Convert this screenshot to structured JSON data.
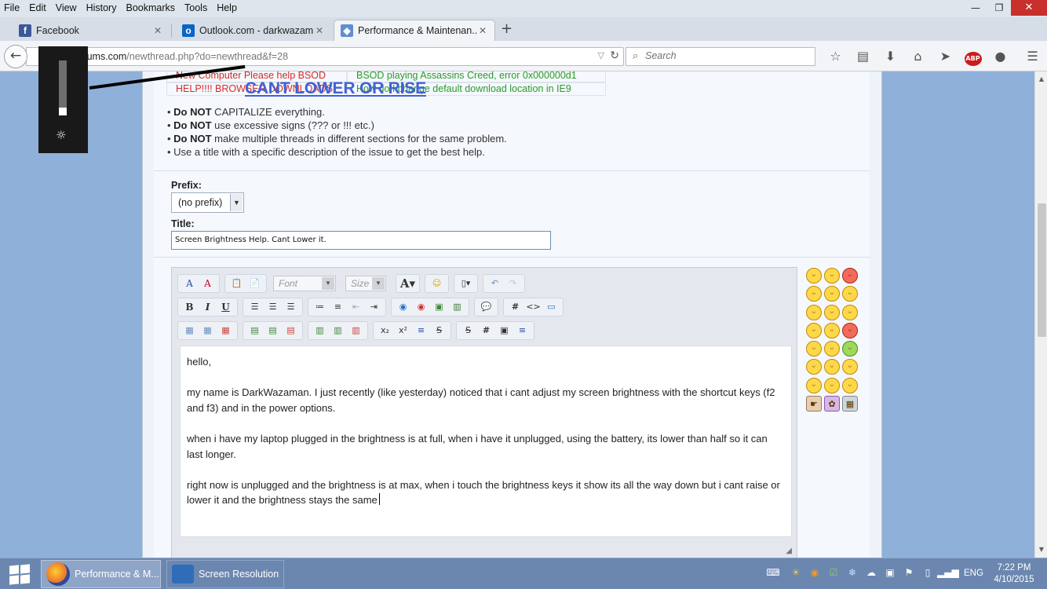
{
  "menu": [
    "File",
    "Edit",
    "View",
    "History",
    "Bookmarks",
    "Tools",
    "Help"
  ],
  "window_controls": {
    "minimize": "—",
    "restore": "❐",
    "close": "✕"
  },
  "tabs": [
    {
      "label": "Facebook",
      "icon": "f",
      "icon_color": "#3b5998"
    },
    {
      "label": "Outlook.com - darkwazam...",
      "icon": "o",
      "icon_color": "#0a64c4"
    },
    {
      "label": "Performance & Maintenan...",
      "icon": "◆",
      "icon_color": "#5f8fd0"
    }
  ],
  "new_tab": "+",
  "nav": {
    "url_domain": "forums.com",
    "url_path": "/newthread.php?do=newthread&f=28",
    "search_placeholder": "Search"
  },
  "similar_threads": [
    {
      "left": "New Computer Please help BSOD",
      "right": "BSOD playing Assassins Creed, error 0x000000d1"
    },
    {
      "left": "HELP!!!! BROWSER DOWNLOADS",
      "right": "How do I change default download location in IE9"
    }
  ],
  "annotation": "CANT LOWER OR  RISE",
  "brightness_level": 0.15,
  "rules": [
    {
      "bold": "Do NOT",
      "text": " CAPITALIZE everything."
    },
    {
      "bold": "Do NOT",
      "text": " use excessive signs (??? or !!! etc.)"
    },
    {
      "bold": "Do NOT",
      "text": " make multiple threads in different sections for the same problem."
    },
    {
      "bold": "",
      "text": "Use a title with a specific description of the issue to get the best help."
    }
  ],
  "form": {
    "prefix_label": "Prefix:",
    "prefix_value": "(no prefix)",
    "title_label": "Title:",
    "title_value": "Screen Brightness Help. Cant Lower it."
  },
  "editor": {
    "font_placeholder": "Font",
    "size_placeholder": "Size",
    "body": [
      "hello,",
      "my name is DarkWazaman. I just recently (like yesterday) noticed that i cant adjust my screen brightness with the shortcut keys (f2 and f3) and in the power options.",
      "when i have my laptop plugged in the brightness is at full, when i have it unplugged, using the battery, its lower than half so it can last longer.",
      "right now is unplugged and the brightness is at max, when i touch the brightness keys it show its all the way down but i cant raise or lower it and the brightness stays the same"
    ]
  },
  "taskbar": {
    "items": [
      {
        "label": "Performance & M...",
        "icon_color": "#e8732a"
      },
      {
        "label": "Screen Resolution",
        "icon_color": "#2f6db8"
      }
    ],
    "language": "ENG",
    "time": "7:22 PM",
    "date": "4/10/2015"
  }
}
